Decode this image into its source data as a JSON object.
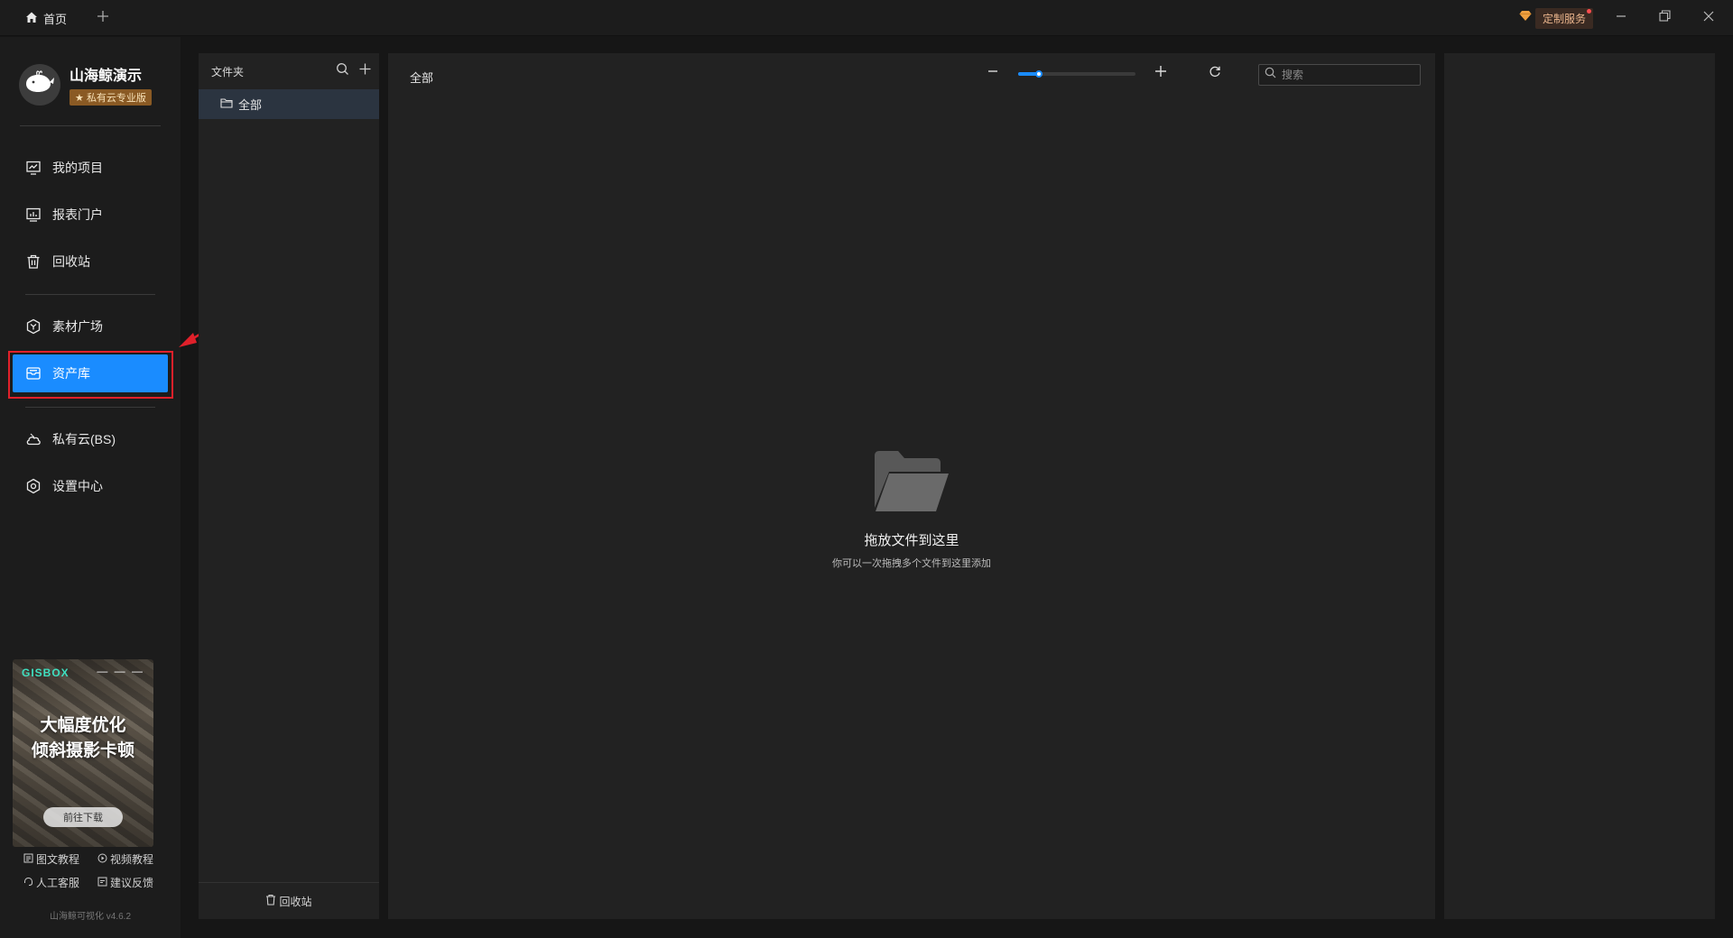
{
  "titlebar": {
    "home_tab": "首页",
    "custom_service": "定制服务"
  },
  "sidebar": {
    "brand_name": "山海鲸演示",
    "brand_badge": "私有云专业版",
    "items": [
      {
        "label": "我的项目",
        "icon": "chart-monitor-icon"
      },
      {
        "label": "报表门户",
        "icon": "report-portal-icon"
      },
      {
        "label": "回收站",
        "icon": "trash-icon"
      },
      {
        "label": "素材广场",
        "icon": "cube-icon"
      },
      {
        "label": "资产库",
        "icon": "asset-box-icon"
      },
      {
        "label": "私有云(BS)",
        "icon": "cloud-icon"
      },
      {
        "label": "设置中心",
        "icon": "gear-icon"
      }
    ],
    "active_item": "资产库",
    "promo": {
      "logo": "GISBOX",
      "dashes": "— — —",
      "line1": "大幅度优化",
      "line2": "倾斜摄影卡顿",
      "cta": "前往下载"
    },
    "help": {
      "tutorial_text": "图文教程",
      "tutorial_video": "视频教程",
      "support": "人工客服",
      "feedback": "建议反馈"
    },
    "version": "山海鲸可视化 v4.6.2"
  },
  "folders": {
    "header": "文件夹",
    "items": [
      {
        "label": "全部",
        "selected": true
      }
    ],
    "footer": "回收站"
  },
  "main": {
    "title": "全部",
    "zoom_level_fraction": 0.18,
    "search_placeholder": "搜索",
    "empty_title": "拖放文件到这里",
    "empty_subtitle": "你可以一次拖拽多个文件到这里添加"
  },
  "colors": {
    "accent": "#1a8cff",
    "highlight": "#e0202a",
    "badge": "#8a5a24"
  }
}
